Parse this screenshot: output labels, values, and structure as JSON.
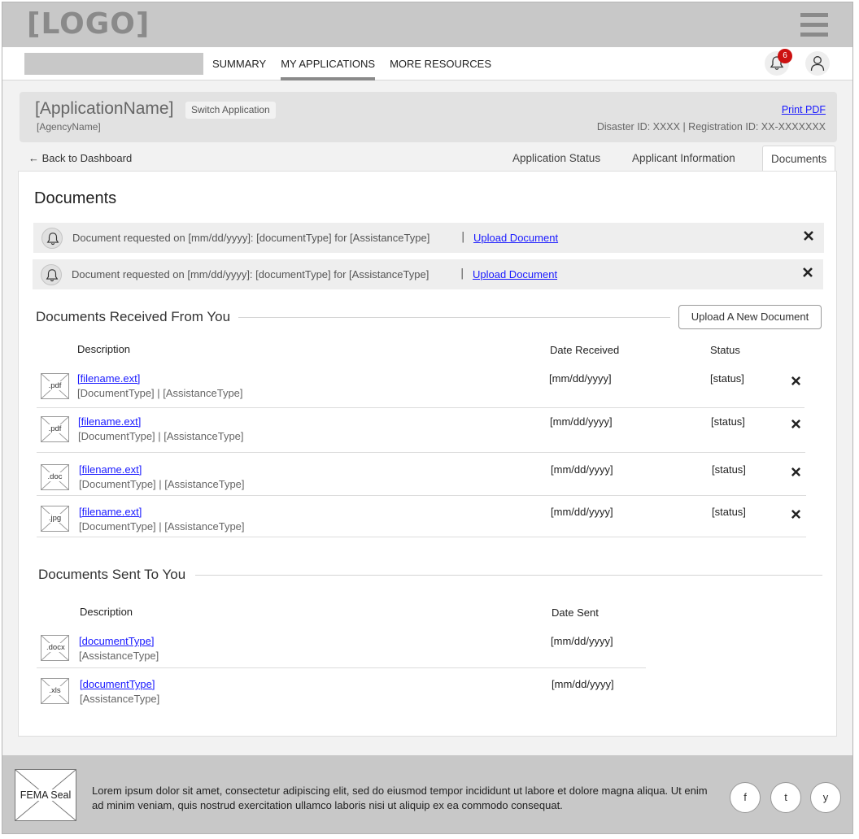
{
  "header": {
    "logo": "[LOGO]",
    "menu_icon": "hamburger-icon"
  },
  "nav": {
    "items": [
      {
        "label": "SUMMARY"
      },
      {
        "label": "MY APPLICATIONS"
      },
      {
        "label": "MORE RESOURCES"
      }
    ],
    "active": "MY APPLICATIONS",
    "notification_count": "6",
    "notification_icon": "bell-icon",
    "user_icon": "user-icon"
  },
  "application": {
    "name": "[ApplicationName]",
    "switch_label": "Switch Application",
    "agency": "[AgencyName]",
    "print_label": "Print PDF",
    "ids": "Disaster ID: XXXX | Registration ID: XX-XXXXXXX"
  },
  "tabs": {
    "back": "← Back to Dashboard",
    "items": [
      {
        "label": "Application Status"
      },
      {
        "label": "Applicant Information"
      },
      {
        "label": "Documents"
      }
    ],
    "active": "Documents"
  },
  "documents": {
    "title": "Documents",
    "alerts": [
      {
        "message": "Document requested on [mm/dd/yyyy]: [documentType] for [AssistanceType]",
        "separator": "|",
        "action": "Upload Document"
      },
      {
        "message": "Document requested on [mm/dd/yyyy]: [documentType] for [AssistanceType]",
        "separator": "|",
        "action": "Upload Document"
      }
    ],
    "received": {
      "title": "Documents Received From You",
      "upload_button": "Upload A New Document",
      "columns": {
        "description": "Description",
        "date": "Date Received",
        "status": "Status"
      },
      "rows": [
        {
          "ext": ".pdf",
          "filename": "[filename.ext]",
          "meta": "[DocumentType] | [AssistanceType]",
          "date": "[mm/dd/yyyy]",
          "status": "[status]"
        },
        {
          "ext": ".pdf",
          "filename": "[filename.ext]",
          "meta": "[DocumentType] | [AssistanceType]",
          "date": "[mm/dd/yyyy]",
          "status": "[status]"
        },
        {
          "ext": ".doc",
          "filename": "[filename.ext]",
          "meta": "[DocumentType] | [AssistanceType]",
          "date": "[mm/dd/yyyy]",
          "status": "[status]"
        },
        {
          "ext": ".jpg",
          "filename": "[filename.ext]",
          "meta": "[DocumentType] | [AssistanceType]",
          "date": "[mm/dd/yyyy]",
          "status": "[status]"
        }
      ]
    },
    "sent": {
      "title": "Documents Sent To You",
      "columns": {
        "description": "Description",
        "date": "Date Sent"
      },
      "rows": [
        {
          "ext": ".docx",
          "name": "[documentType]",
          "meta": "[AssistanceType]",
          "date": "[mm/dd/yyyy]"
        },
        {
          "ext": ".xls",
          "name": "[documentType]",
          "meta": "[AssistanceType]",
          "date": "[mm/dd/yyyy]"
        }
      ]
    }
  },
  "footer": {
    "seal": "FEMA Seal",
    "text": "Lorem ipsum dolor sit amet, consectetur adipiscing elit, sed do eiusmod tempor incididunt ut labore et dolore magna aliqua. Ut enim ad minim veniam, quis nostrud exercitation ullamco laboris nisi ut aliquip ex ea commodo consequat.",
    "social": [
      {
        "label": "f"
      },
      {
        "label": "t"
      },
      {
        "label": "y"
      }
    ]
  }
}
